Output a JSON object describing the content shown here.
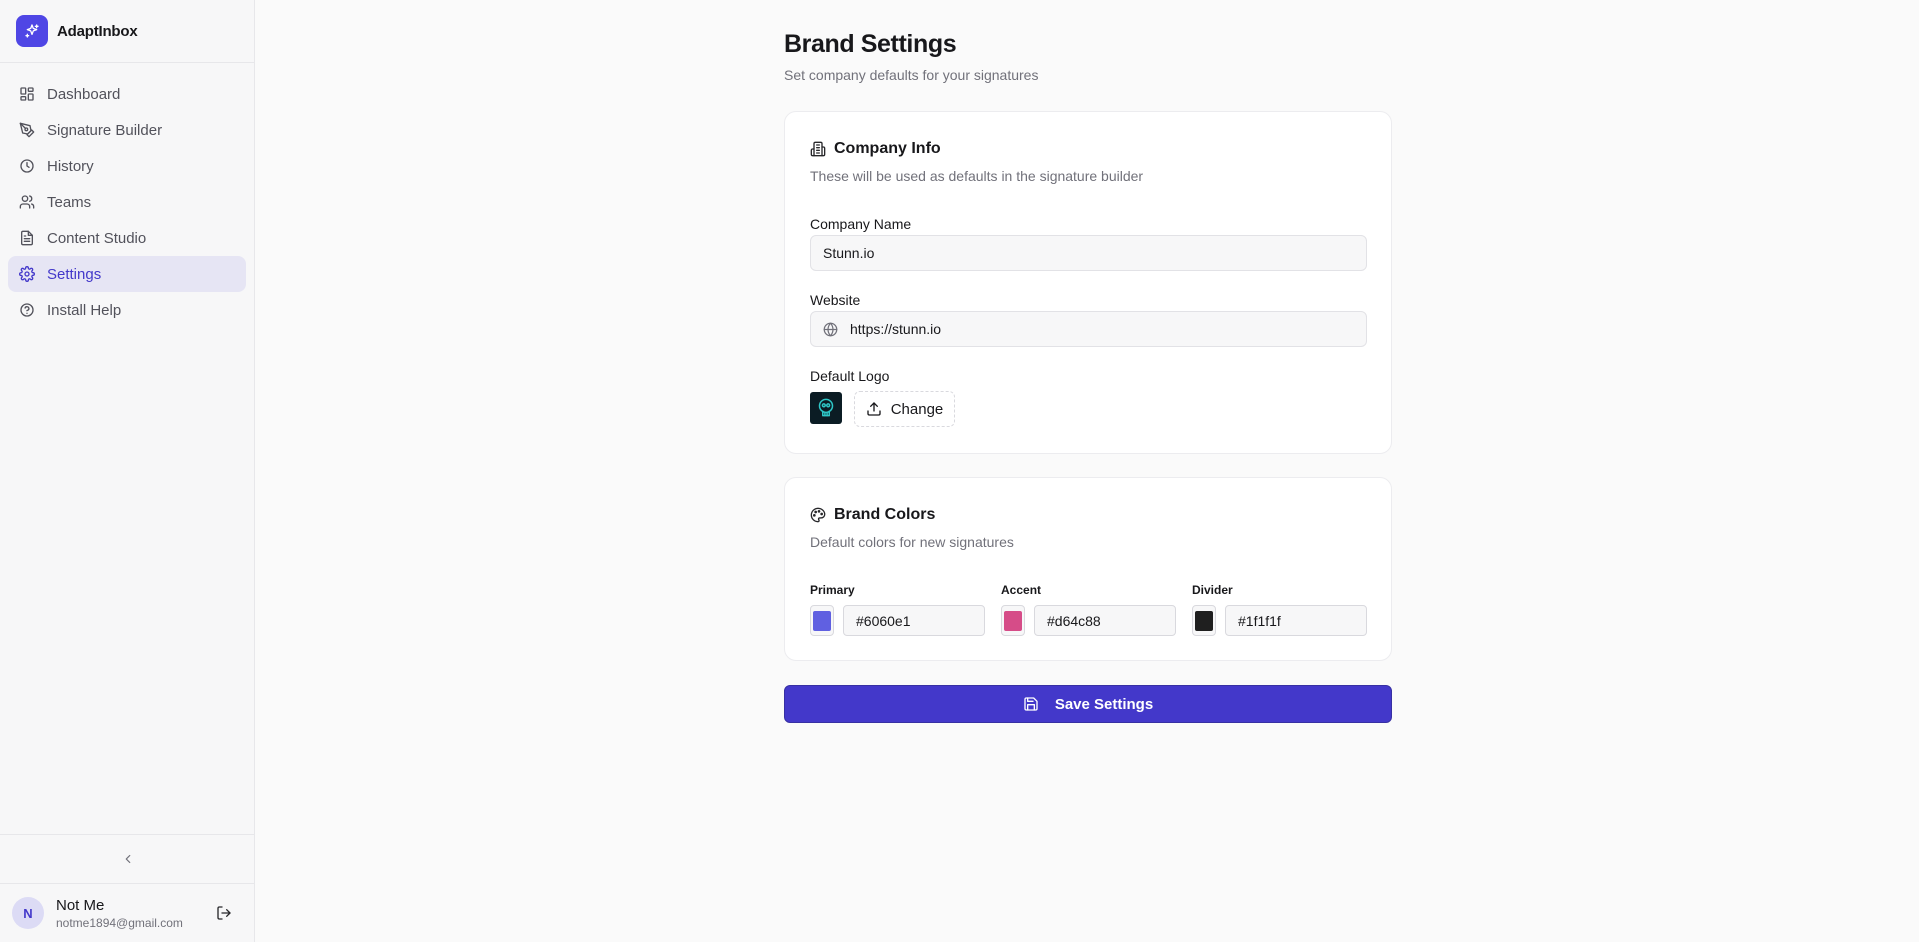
{
  "app": {
    "name": "AdaptInbox"
  },
  "sidebar": {
    "items": [
      {
        "label": "Dashboard",
        "icon": "dashboard-icon",
        "active": false
      },
      {
        "label": "Signature Builder",
        "icon": "pen-tool-icon",
        "active": false
      },
      {
        "label": "History",
        "icon": "clock-icon",
        "active": false
      },
      {
        "label": "Teams",
        "icon": "users-icon",
        "active": false
      },
      {
        "label": "Content Studio",
        "icon": "file-text-icon",
        "active": false
      },
      {
        "label": "Settings",
        "icon": "gear-icon",
        "active": true
      },
      {
        "label": "Install Help",
        "icon": "help-circle-icon",
        "active": false
      }
    ],
    "collapse_icon": "chevron-left-icon"
  },
  "user": {
    "initial": "N",
    "name": "Not Me",
    "email": "notme1894@gmail.com"
  },
  "page": {
    "title": "Brand Settings",
    "subtitle": "Set company defaults for your signatures"
  },
  "company_info": {
    "title": "Company Info",
    "subtitle": "These will be used as defaults in the signature builder",
    "company_name_label": "Company Name",
    "company_name_value": "Stunn.io",
    "website_label": "Website",
    "website_value": "https://stunn.io",
    "logo_label": "Default Logo",
    "change_label": "Change"
  },
  "brand_colors": {
    "title": "Brand Colors",
    "subtitle": "Default colors for new signatures",
    "colors": [
      {
        "label": "Primary",
        "value": "#6060e1"
      },
      {
        "label": "Accent",
        "value": "#d64c88"
      },
      {
        "label": "Divider",
        "value": "#1f1f1f"
      }
    ]
  },
  "save_label": "Save Settings",
  "theme": {
    "accent": "#4338ca",
    "active_bg": "#e6e5f4"
  }
}
